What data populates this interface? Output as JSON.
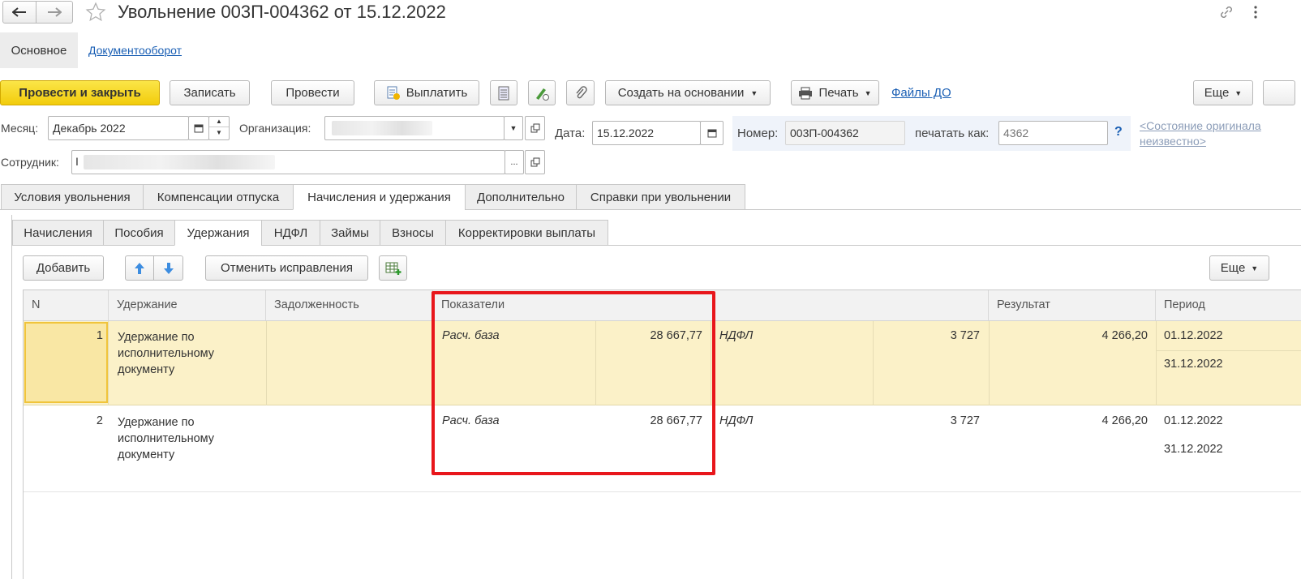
{
  "window": {
    "title": "Увольнение 003П-004362 от 15.12.2022"
  },
  "nav_tabs": {
    "main": "Основное",
    "docflow": "Документооборот"
  },
  "toolbar": {
    "post_close": "Провести и закрыть",
    "save": "Записать",
    "post": "Провести",
    "pay": "Выплатить",
    "create_based": "Создать на основании",
    "print": "Печать",
    "files": "Файлы ДО",
    "more": "Еще"
  },
  "form": {
    "month_label": "Месяц:",
    "month_value": "Декабрь 2022",
    "org_label": "Организация:",
    "date_label": "Дата:",
    "date_value": "15.12.2022",
    "number_label": "Номер:",
    "number_value": "003П-004362",
    "print_as_label": "печатать как:",
    "print_as_placeholder": "4362",
    "help": "?",
    "original_state_line1": "<Состояние оригинала",
    "original_state_line2": "неизвестно>",
    "employee_label": "Сотрудник:",
    "employee_value": "I",
    "dots": "..."
  },
  "main_tabs": [
    "Условия увольнения",
    "Компенсации отпуска",
    "Начисления и удержания",
    "Дополнительно",
    "Справки при увольнении"
  ],
  "sub_tabs": [
    "Начисления",
    "Пособия",
    "Удержания",
    "НДФЛ",
    "Займы",
    "Взносы",
    "Корректировки выплаты"
  ],
  "table_toolbar": {
    "add": "Добавить",
    "cancel_fixes": "Отменить исправления",
    "more": "Еще"
  },
  "table": {
    "columns": [
      "N",
      "Удержание",
      "Задолженность",
      "Показатели",
      "Результат",
      "Период"
    ],
    "rows": [
      {
        "n": "1",
        "deduction": [
          "Удержание по",
          "исполнительному",
          "документу"
        ],
        "ind1_name": "Расч. база",
        "ind1_value": "28 667,77",
        "ind2_name": "НДФЛ",
        "ind2_value": "3 727",
        "result": "4 266,20",
        "period_from": "01.12.2022",
        "period_to": "31.12.2022"
      },
      {
        "n": "2",
        "deduction": [
          "Удержание по",
          "исполнительному",
          "документу"
        ],
        "ind1_name": "Расч. база",
        "ind1_value": "28 667,77",
        "ind2_name": "НДФЛ",
        "ind2_value": "3 727",
        "result": "4 266,20",
        "period_from": "01.12.2022",
        "period_to": "31.12.2022"
      }
    ]
  },
  "colors": {
    "primary_button": "#f2cc0c",
    "selected_row": "#fbf1c8",
    "highlight_frame": "#e8161b",
    "link": "#1a5fb4"
  }
}
